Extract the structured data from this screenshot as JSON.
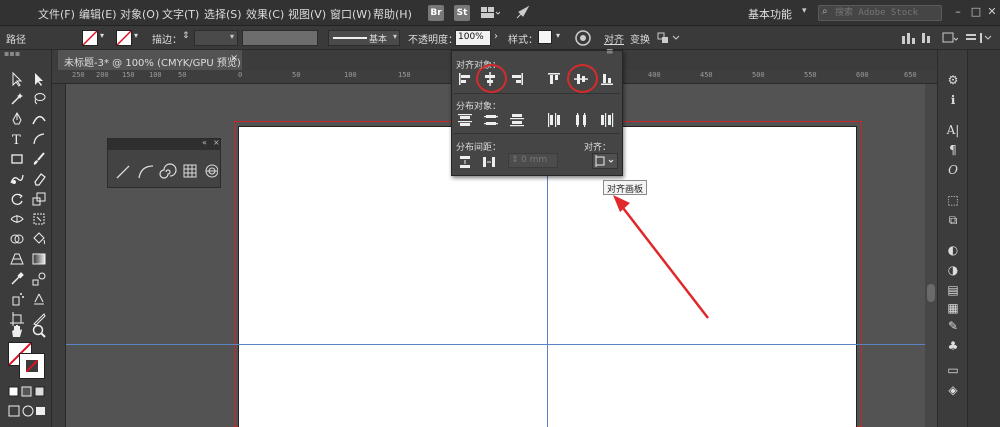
{
  "menu": [
    "文件(F)",
    "编辑(E)",
    "对象(O)",
    "文字(T)",
    "选择(S)",
    "效果(C)",
    "视图(V)",
    "窗口(W)",
    "帮助(H)"
  ],
  "app_badges": [
    "Br",
    "St"
  ],
  "workspace": "基本功能",
  "search": {
    "placeholder": "搜索 Adobe Stock"
  },
  "control_bar": {
    "path_label": "路径",
    "stroke_label": "描边：",
    "stroke_style": "基本",
    "opacity_label": "不透明度：",
    "opacity_value": "100%",
    "style_label": "样式：",
    "align_label": "对齐",
    "transform_label": "变换"
  },
  "document_tab": {
    "title": "未标题-3* @ 100% (CMYK/GPU 预览)",
    "close": "×"
  },
  "ruler_ticks": [
    "250",
    "200",
    "150",
    "100",
    "50",
    "0",
    "50",
    "100",
    "150",
    "200",
    "250",
    "300",
    "350",
    "400",
    "450",
    "500",
    "550",
    "600",
    "650"
  ],
  "align_panel": {
    "section_align_objects": "对齐对象：",
    "section_distribute_objects": "分布对象：",
    "section_distribute_spacing": "分布间距：",
    "spacing_value": "0 mm",
    "align_to_label": "对齐："
  },
  "tooltip": "对齐画板",
  "colors": {
    "highlight_circle": "#d62b2b",
    "arrow": "#e0282a",
    "guide": "#5b84c4",
    "artboard_bleed": "#c8262a"
  }
}
